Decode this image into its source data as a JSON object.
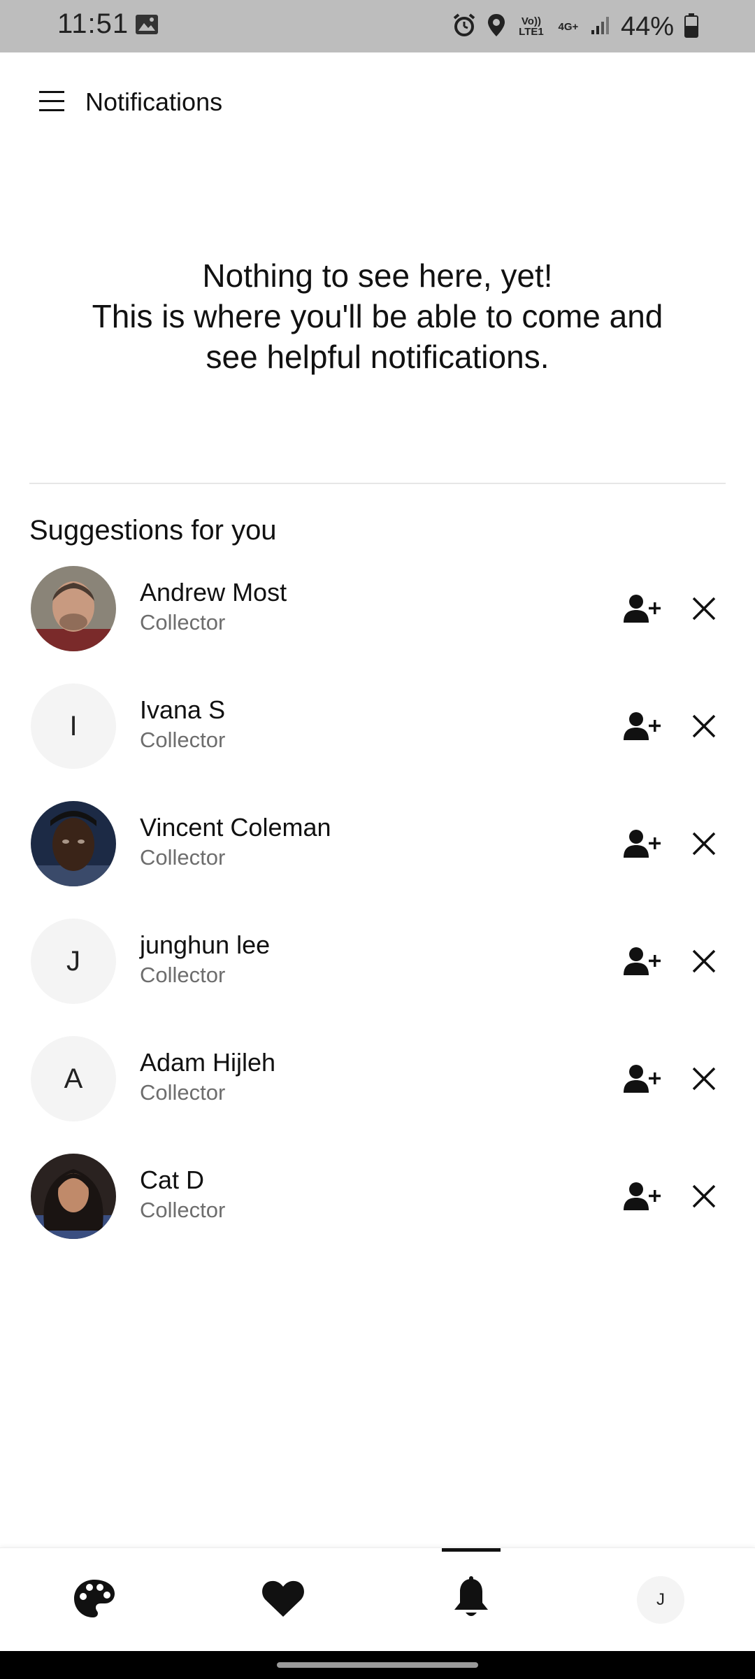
{
  "status_bar": {
    "time": "11:51",
    "network_top": "Vo)) LTE1",
    "network_4g": "4G+",
    "battery": "44%"
  },
  "header": {
    "title": "Notifications"
  },
  "empty_state": {
    "line1": "Nothing to see here, yet!",
    "line2": "This is where you'll be able to come and",
    "line3": "see helpful notifications."
  },
  "suggestions": {
    "title": "Suggestions for you",
    "items": [
      {
        "name": "Andrew Most",
        "role": "Collector",
        "initial": "",
        "avatar": "photo"
      },
      {
        "name": "Ivana S",
        "role": "Collector",
        "initial": "I",
        "avatar": "initial"
      },
      {
        "name": "Vincent Coleman",
        "role": "Collector",
        "initial": "",
        "avatar": "photo"
      },
      {
        "name": "junghun lee",
        "role": "Collector",
        "initial": "J",
        "avatar": "initial"
      },
      {
        "name": "Adam Hijleh",
        "role": "Collector",
        "initial": "A",
        "avatar": "initial"
      },
      {
        "name": "Cat D",
        "role": "Collector",
        "initial": "",
        "avatar": "photo"
      }
    ]
  },
  "bottom_nav": {
    "items": [
      "palette-icon",
      "heart-icon",
      "bell-icon",
      "profile-avatar"
    ],
    "active": "bell-icon",
    "profile_initial": "J"
  }
}
